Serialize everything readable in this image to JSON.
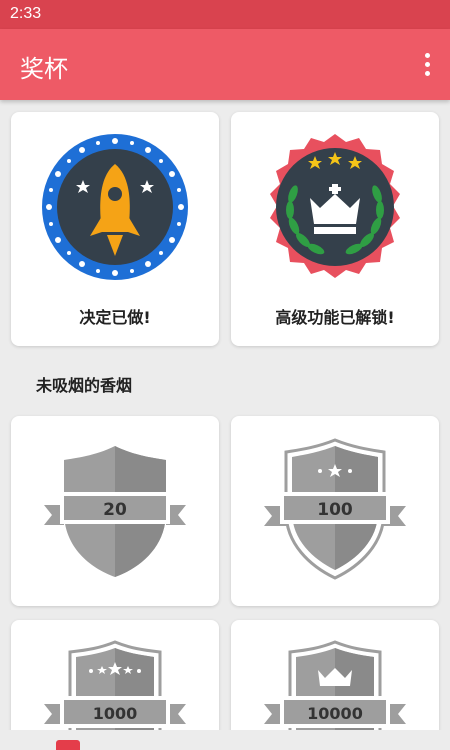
{
  "status_bar": {
    "time": "2:33"
  },
  "app_bar": {
    "title": "奖杯",
    "overflow_icon": "more-vert-icon"
  },
  "achievements": [
    {
      "label": "决定已做!",
      "icon": "rocket-badge-icon"
    },
    {
      "label": "高级功能已解锁!",
      "icon": "crown-laurel-badge-icon"
    }
  ],
  "section": {
    "title": "未吸烟的香烟"
  },
  "cigarette_badges": [
    {
      "value": "20",
      "icon": "shield-badge-icon"
    },
    {
      "value": "100",
      "icon": "stars-shield-badge-icon"
    },
    {
      "value": "1000",
      "icon": "stars-shield-badge-icon"
    },
    {
      "value": "10000",
      "icon": "crown-shield-badge-icon"
    }
  ],
  "colors": {
    "status_bar": "#d9434f",
    "app_bar": "#ee5a66",
    "background": "#ececec"
  }
}
